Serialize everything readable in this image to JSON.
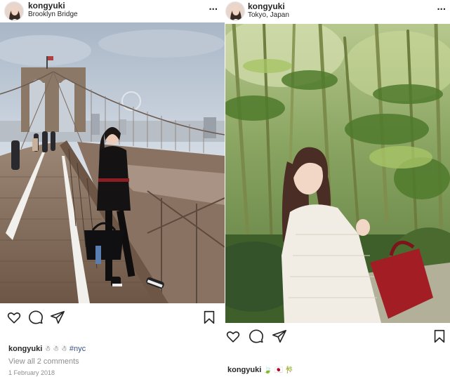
{
  "posts": [
    {
      "username": "kongyuki",
      "location": "Brooklyn Bridge",
      "more_label": "...",
      "caption_emojis": "☃ ☃ ☃",
      "hashtag": "#nyc",
      "comments_label": "View all 2 comments",
      "date": "1 February 2018",
      "photo_subject": "woman posing on wooden walkway of Brooklyn Bridge"
    },
    {
      "username": "kongyuki",
      "location": "Tokyo, Japan",
      "more_label": "...",
      "caption_emojis": "🍃 🇯🇵 🎋",
      "photo_subject": "woman in white jacket among bamboo trees"
    }
  ],
  "icons": {
    "like": "heart-icon",
    "comment": "comment-icon",
    "share": "paper-plane-icon",
    "save": "bookmark-icon",
    "more": "more-options-icon"
  },
  "colors": {
    "text": "#262626",
    "muted": "#8e8e8e",
    "hashtag": "#385185"
  }
}
